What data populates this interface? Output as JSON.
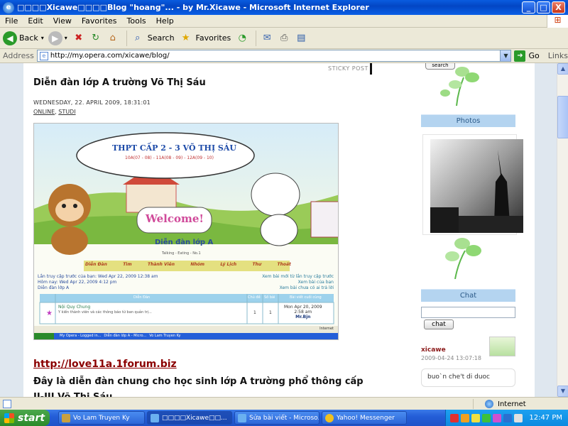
{
  "window": {
    "title": "□□□□Xicawe□□□□Blog \"hoang\"... - by Mr.Xicawe - Microsoft Internet Explorer",
    "minimize": "_",
    "maximize": "□",
    "close": "X"
  },
  "menu": [
    "File",
    "Edit",
    "View",
    "Favorites",
    "Tools",
    "Help"
  ],
  "toolbar": {
    "back": "Back",
    "search": "Search",
    "favorites": "Favorites"
  },
  "address": {
    "label": "Address",
    "url": "http://my.opera.com/xicawe/blog/",
    "go": "Go",
    "links": "Links"
  },
  "post": {
    "sticky": "STICKY POST",
    "title": "Diễn đàn lớp A trường Võ Thị Sáu",
    "date": "WEDNESDAY, 22. APRIL 2009, 18:31:01",
    "tag1": "ONLINE",
    "tag2": "STUDI",
    "link": "http://love11a.1forum.biz",
    "text": "Đây là diễn đàn chung cho học sinh lớp A trường phổ thông cấp II-III Võ Thị Sáu"
  },
  "screenshot": {
    "banner_title": "THPT CẤP 2 - 3 VÕ THỊ SÁU",
    "banner_sub": "10A(07 - 08) - 11A(08 - 09) - 12A(09 - 10)",
    "welcome": "Welcome!",
    "forum_name": "Diễn đàn lớp A",
    "tagline": "Talking - Eating - No.1",
    "nav": [
      "Diễn Đàn",
      "Tìm",
      "Thành Viên",
      "Nhóm",
      "Lý Lịch",
      "Thư",
      "Thoát"
    ],
    "last_visit": "Lần truy cập trước của bạn: Wed Apr 22, 2009 12:38 am",
    "today": "Hôm nay: Wed Apr 22, 2009 4:12 pm",
    "forum_link": "Diễn đàn lớp A",
    "right1": "Xem bài mới từ lần truy cập trước",
    "right2": "Xem bài của bạn",
    "right3": "Xem bài chưa có ai trả lời",
    "col1": "Diễn Đàn",
    "col2": "Chủ đề",
    "col3": "Số bài",
    "col4": "Bài viết cuối cùng",
    "row_name": "Nội Quy Chung",
    "row_desc": "Y kiến thành viên và các thông báo từ ban quản trị...",
    "row_topics": "1",
    "row_posts": "1",
    "row_last": "Mon Apr 20, 2009",
    "row_last_time": "2:58 am",
    "row_last_user": "Mr.Bjn",
    "inner_status": "Internet",
    "inner_tasks": [
      "My Opera - Logged in...",
      "Diễn đàn lớp A - Micro...",
      "Vo Lam Truyen Ky"
    ]
  },
  "sidebar": {
    "search": "search",
    "photos": "Photos",
    "chat_head": "Chat",
    "chat_button": "chat",
    "chat_user": "xicawe",
    "chat_time": "2009-04-24 13:07:18",
    "chat_msg": "buo`n che't di duoc"
  },
  "status": {
    "zone": "Internet"
  },
  "taskbar": {
    "start": "start",
    "tasks": [
      "Vo Lam Truyen Ky",
      "□□□□Xicawe□□...",
      "Sửa bài viết - Microso...",
      "Yahoo! Messenger"
    ],
    "clock": "12:47 PM"
  },
  "colors": {
    "title_blue": "#0a5ce0",
    "link_red": "#8b0000",
    "widget_blue": "#b4d4f0",
    "taskbar_blue": "#245ed8",
    "start_green": "#2a8a2a"
  }
}
